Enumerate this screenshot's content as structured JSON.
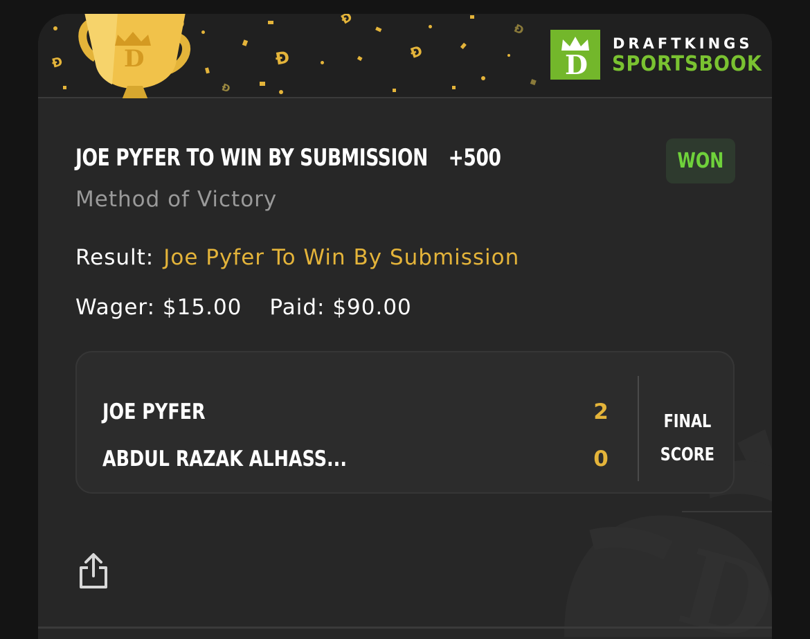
{
  "brand": {
    "name_line1": "DRAFTKINGS",
    "name_line2": "SPORTSBOOK",
    "logo_color": "#73b72b"
  },
  "bet": {
    "selection": "JOE PYFER TO WIN BY SUBMISSION",
    "odds": "+500",
    "status": "WON",
    "market": "Method of Victory",
    "result_label": "Result:",
    "result_value": "Joe Pyfer To Win By Submission",
    "wager_label": "Wager:",
    "wager_value": "$15.00",
    "paid_label": "Paid:",
    "paid_value": "$90.00"
  },
  "scoreboard": {
    "teams": [
      {
        "name": "JOE PYFER",
        "score": "2"
      },
      {
        "name": "ABDUL RAZAK ALHASS...",
        "score": "0"
      }
    ],
    "final_line1": "FINAL",
    "final_line2": "SCORE"
  },
  "actions": {
    "share_icon": "share-icon"
  },
  "colors": {
    "accent_gold": "#e4b43a",
    "won_green": "#6fd13b",
    "background": "#272727"
  }
}
